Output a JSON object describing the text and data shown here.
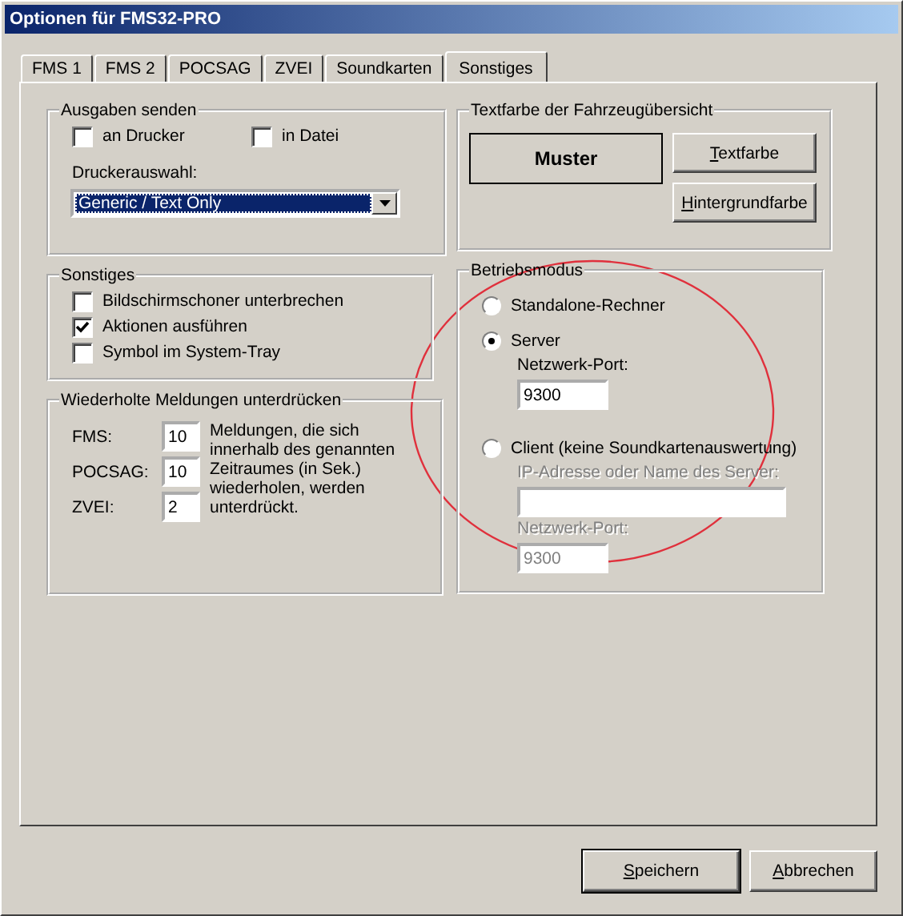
{
  "window": {
    "title": "Optionen für FMS32-PRO"
  },
  "tabs": [
    {
      "label": "FMS 1",
      "selected": false
    },
    {
      "label": "FMS 2",
      "selected": false
    },
    {
      "label": "POCSAG",
      "selected": false
    },
    {
      "label": "ZVEI",
      "selected": false
    },
    {
      "label": "Soundkarten",
      "selected": false
    },
    {
      "label": "Sonstiges",
      "selected": true
    }
  ],
  "ausgaben_senden": {
    "title": "Ausgaben senden",
    "checkboxes": [
      {
        "label": "an Drucker",
        "checked": false
      },
      {
        "label": "in Datei",
        "checked": false
      }
    ],
    "printer_label": "Druckerauswahl:",
    "printer_select": {
      "value": "Generic / Text Only",
      "selected": true
    }
  },
  "textfarbe": {
    "title": "Textfarbe der Fahrzeugübersicht",
    "sample": "Muster",
    "buttons": [
      "Textfarbe",
      "Hintergrundfarbe"
    ]
  },
  "sonstiges": {
    "title": "Sonstiges",
    "checkboxes": [
      {
        "label": "Bildschirmschoner unterbrechen",
        "checked": false
      },
      {
        "label": "Aktionen ausführen",
        "checked": true
      },
      {
        "label": "Symbol im System-Tray",
        "checked": false
      }
    ]
  },
  "betriebsmodus": {
    "title": "Betriebsmodus",
    "options": [
      {
        "label": "Standalone-Rechner",
        "selected": false
      },
      {
        "label": "Server",
        "selected": true,
        "fields": [
          {
            "kind": "port",
            "label": "Netzwerk-Port:",
            "value": "9300",
            "disabled": false
          }
        ]
      },
      {
        "label": "Client (keine Soundkartenauswertung)",
        "selected": false,
        "fields": [
          {
            "kind": "address",
            "label": "IP-Adresse oder Name des Server:",
            "disabled": true
          },
          {
            "kind": "port",
            "label": "Netzwerk-Port:",
            "value": "9300",
            "disabled": true
          }
        ]
      }
    ]
  },
  "unterdruecken": {
    "title": "Wiederholte Meldungen unterdrücken",
    "rows": [
      {
        "label": "FMS:",
        "value": "10"
      },
      {
        "label": "POCSAG:",
        "value": "10"
      },
      {
        "label": "ZVEI:",
        "value": "2"
      }
    ],
    "note": "Meldungen, die sich innerhalb des genannten Zeitraumes (in Sek.) wiederholen, werden unterdrückt."
  },
  "buttons": [
    "Speichern",
    "Abbrechen"
  ]
}
